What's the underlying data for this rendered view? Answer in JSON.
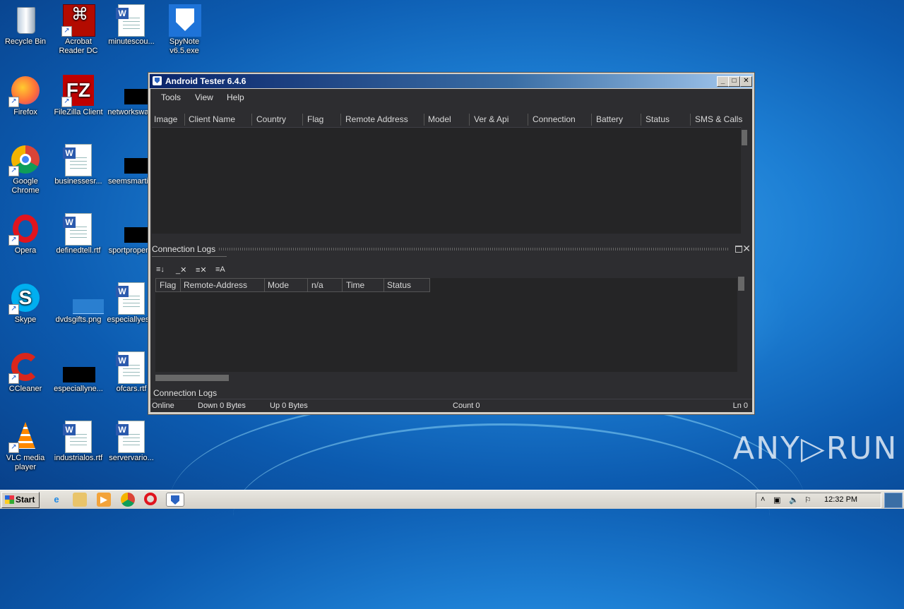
{
  "desktop": {
    "icons": [
      {
        "label": "Recycle Bin"
      },
      {
        "label": "Acrobat Reader DC"
      },
      {
        "label": "minutescou..."
      },
      {
        "label": "SpyNote v6.5.exe"
      },
      {
        "label": "Firefox"
      },
      {
        "label": "FileZilla Client"
      },
      {
        "label": "networkswa..."
      },
      {
        "label": "Google Chrome"
      },
      {
        "label": "businessesr..."
      },
      {
        "label": "seemsmarti..."
      },
      {
        "label": "Opera"
      },
      {
        "label": "definedtell.rtf"
      },
      {
        "label": "sportproper..."
      },
      {
        "label": "Skype"
      },
      {
        "label": "dvdsgifts.png"
      },
      {
        "label": "especiallyes..."
      },
      {
        "label": "CCleaner"
      },
      {
        "label": "especiallyne..."
      },
      {
        "label": "ofcars.rtf"
      },
      {
        "label": "VLC media player"
      },
      {
        "label": "industrialos.rtf"
      },
      {
        "label": "servervario..."
      }
    ]
  },
  "window": {
    "title": "Android Tester 6.4.6",
    "controls": {
      "minimize": "_",
      "maximize": "□",
      "close": "✕"
    },
    "menu": [
      "Tools",
      "View",
      "Help"
    ],
    "clients_grid": {
      "columns": [
        "Image",
        "Client Name",
        "Country",
        "Flag",
        "Remote Address",
        "Model",
        "Ver & Api",
        "Connection",
        "Battery",
        "Status",
        "SMS & Calls"
      ]
    },
    "logs_panel": {
      "title": "Connection Logs",
      "toolbar": [
        "≡↓",
        "_✕",
        "≡✕",
        "≡A"
      ],
      "columns": [
        "Flag",
        "Remote-Address",
        "Mode",
        "n/a",
        "Time",
        "Status"
      ]
    },
    "doc_tab": "Connection Logs",
    "status": {
      "state": "Online",
      "down": "Down 0 Bytes",
      "up": "Up 0 Bytes",
      "count": "Count 0",
      "ln": "Ln 0"
    }
  },
  "taskbar": {
    "start_label": "Start",
    "clock": "12:32 PM"
  },
  "watermark": "ANY▷RUN"
}
